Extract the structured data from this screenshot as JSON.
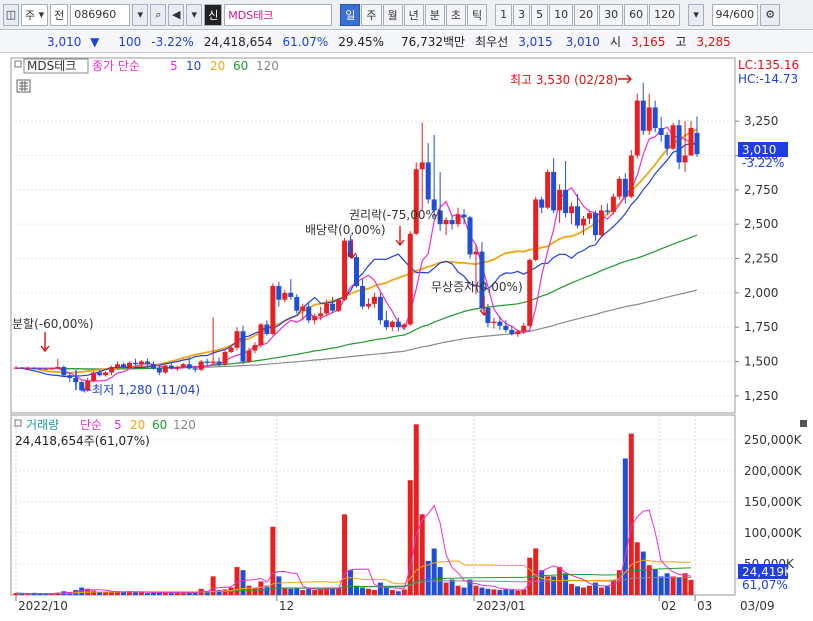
{
  "toolbar": {
    "kind_label": "주",
    "jeon_label": "전",
    "code": "086960",
    "name": "MDS테크",
    "sin_label": "신",
    "periods": [
      "일",
      "주",
      "월",
      "년",
      "분",
      "초",
      "틱"
    ],
    "minutes": [
      "1",
      "3",
      "5",
      "10",
      "20",
      "30",
      "60",
      "120"
    ],
    "count": "94",
    "count_total": "/600"
  },
  "quote": {
    "price": "3,010",
    "change": "100",
    "change_pct": "-3.22%",
    "volume": "24,418,654",
    "vol_ratio": "61.07%",
    "turnover": "29.45%",
    "amount": "76,732백만",
    "bid_label": "최우선",
    "bid1": "3,015",
    "bid2": "3,010",
    "open_label": "시",
    "open": "3,165",
    "high_label": "고",
    "high": "3,285"
  },
  "price_panel": {
    "name_tag": "MDS테크",
    "ma_label": "종가 단순",
    "ma_periods": [
      "5",
      "10",
      "20",
      "60",
      "120"
    ],
    "lc": "LC:135.16",
    "hc": "HC:-14.73",
    "current_price": "3,010",
    "current_pct": "-3.22%",
    "annotations": {
      "high": "최고 3,530 (02/28)",
      "low": "←최저 1,280 (11/04)",
      "split": "분할(-60,00%)",
      "dividend": "배당락(0,00%)",
      "rights": "권리락(-75,00%)",
      "bonus": "무상증자(0,00%)"
    }
  },
  "volume_panel": {
    "label": "거래량",
    "ma_label": "단순",
    "ma_periods": [
      "5",
      "20",
      "60",
      "120"
    ],
    "volume_text": "24,418,654주(61,07%)",
    "current": "24,419K",
    "current_pct": "61,07%"
  },
  "colors": {
    "up": "#e82020",
    "down": "#1e4fd6",
    "ma5": "#ee2ecf",
    "ma10": "#1f3fd9",
    "ma20": "#f0a612",
    "ma60": "#1e9a2e",
    "ma120": "#8a8a8a"
  },
  "chart_data": {
    "type": "candlestick",
    "price_axis": {
      "ticks": [
        1250,
        1500,
        1750,
        2000,
        2250,
        2500,
        2750,
        3000,
        3250
      ],
      "tick_labels": [
        "1,250",
        "1,500",
        "1,750",
        "2,000",
        "2,250",
        "2,500",
        "2,750",
        "3,000",
        "3,250"
      ],
      "range": [
        1125,
        3710
      ]
    },
    "volume_axis": {
      "ticks": [
        50,
        100,
        150,
        200,
        250
      ],
      "tick_labels": [
        "50,000K",
        "100,000K",
        "150,000K",
        "200,000K",
        "250,000K"
      ],
      "range": [
        0,
        290
      ],
      "unit": "K"
    },
    "x_labels": [
      "2022/10",
      "12",
      "2023/01",
      "02",
      "03",
      "03/09"
    ],
    "candles": [
      [
        1455,
        1465,
        1445,
        1455
      ],
      [
        1455,
        1460,
        1445,
        1450
      ],
      [
        1452,
        1462,
        1445,
        1452
      ],
      [
        1452,
        1460,
        1445,
        1450
      ],
      [
        1450,
        1455,
        1440,
        1448
      ],
      [
        1448,
        1452,
        1440,
        1445
      ],
      [
        1445,
        1455,
        1440,
        1450
      ],
      [
        1450,
        1520,
        1445,
        1460
      ],
      [
        1460,
        1470,
        1390,
        1400
      ],
      [
        1400,
        1420,
        1350,
        1380
      ],
      [
        1380,
        1400,
        1330,
        1350
      ],
      [
        1350,
        1360,
        1280,
        1290
      ],
      [
        1290,
        1380,
        1280,
        1360
      ],
      [
        1360,
        1430,
        1350,
        1420
      ],
      [
        1420,
        1440,
        1390,
        1400
      ],
      [
        1400,
        1430,
        1390,
        1420
      ],
      [
        1420,
        1470,
        1400,
        1460
      ],
      [
        1460,
        1500,
        1440,
        1480
      ],
      [
        1480,
        1490,
        1450,
        1460
      ],
      [
        1460,
        1500,
        1450,
        1490
      ],
      [
        1490,
        1520,
        1470,
        1480
      ],
      [
        1480,
        1510,
        1460,
        1500
      ],
      [
        1500,
        1520,
        1470,
        1480
      ],
      [
        1480,
        1500,
        1440,
        1450
      ],
      [
        1450,
        1470,
        1400,
        1420
      ],
      [
        1420,
        1480,
        1410,
        1470
      ],
      [
        1470,
        1490,
        1440,
        1450
      ],
      [
        1450,
        1470,
        1430,
        1460
      ],
      [
        1460,
        1490,
        1450,
        1480
      ],
      [
        1480,
        1530,
        1440,
        1450
      ],
      [
        1450,
        1470,
        1420,
        1440
      ],
      [
        1440,
        1510,
        1430,
        1500
      ],
      [
        1500,
        1520,
        1470,
        1490
      ],
      [
        1490,
        1820,
        1480,
        1500
      ],
      [
        1500,
        1530,
        1460,
        1480
      ],
      [
        1480,
        1580,
        1470,
        1570
      ],
      [
        1570,
        1620,
        1560,
        1600
      ],
      [
        1600,
        1750,
        1580,
        1720
      ],
      [
        1720,
        1760,
        1480,
        1500
      ],
      [
        1500,
        1600,
        1490,
        1580
      ],
      [
        1580,
        1640,
        1560,
        1620
      ],
      [
        1620,
        1780,
        1600,
        1770
      ],
      [
        1770,
        1800,
        1690,
        1700
      ],
      [
        1700,
        2070,
        1690,
        2050
      ],
      [
        2050,
        2080,
        1900,
        1950
      ],
      [
        1950,
        2020,
        1930,
        2000
      ],
      [
        2000,
        2100,
        1950,
        1970
      ],
      [
        1970,
        1990,
        1850,
        1870
      ],
      [
        1870,
        1920,
        1800,
        1900
      ],
      [
        1900,
        1930,
        1780,
        1800
      ],
      [
        1800,
        1850,
        1770,
        1830
      ],
      [
        1830,
        1900,
        1800,
        1850
      ],
      [
        1850,
        1950,
        1830,
        1920
      ],
      [
        1920,
        1970,
        1850,
        1870
      ],
      [
        1870,
        1960,
        1860,
        1950
      ],
      [
        1950,
        2400,
        1940,
        2380
      ],
      [
        2380,
        2420,
        2250,
        2260
      ],
      [
        2260,
        2280,
        2040,
        2050
      ],
      [
        2050,
        2100,
        1880,
        1900
      ],
      [
        1900,
        1960,
        1880,
        1920
      ],
      [
        1920,
        2000,
        1890,
        1970
      ],
      [
        1970,
        2000,
        1770,
        1800
      ],
      [
        1800,
        1870,
        1730,
        1750
      ],
      [
        1750,
        1800,
        1720,
        1790
      ],
      [
        1790,
        1820,
        1720,
        1750
      ],
      [
        1750,
        1780,
        1740,
        1770
      ],
      [
        1770,
        2450,
        1760,
        2430
      ],
      [
        2430,
        2950,
        2420,
        2900
      ],
      [
        2900,
        3240,
        2600,
        2950
      ],
      [
        2950,
        3090,
        2650,
        2680
      ],
      [
        2680,
        3150,
        2550,
        2600
      ],
      [
        2600,
        2880,
        2450,
        2500
      ],
      [
        2500,
        2550,
        2420,
        2530
      ],
      [
        2530,
        2560,
        2460,
        2500
      ],
      [
        2500,
        2620,
        2480,
        2570
      ],
      [
        2570,
        2610,
        2500,
        2550
      ],
      [
        2550,
        2560,
        2250,
        2280
      ],
      [
        2280,
        2350,
        1990,
        2300
      ],
      [
        2300,
        2370,
        1870,
        1890
      ],
      [
        1890,
        1920,
        1750,
        1780
      ],
      [
        1780,
        1820,
        1740,
        1790
      ],
      [
        1790,
        1830,
        1730,
        1760
      ],
      [
        1760,
        1800,
        1710,
        1730
      ],
      [
        1730,
        1760,
        1690,
        1700
      ],
      [
        1700,
        1730,
        1680,
        1720
      ],
      [
        1720,
        1780,
        1700,
        1760
      ],
      [
        1760,
        2250,
        1750,
        2240
      ],
      [
        2240,
        2700,
        2230,
        2680
      ],
      [
        2680,
        2700,
        2580,
        2620
      ],
      [
        2620,
        2900,
        2610,
        2880
      ],
      [
        2880,
        2980,
        2580,
        2600
      ],
      [
        2600,
        2790,
        2510,
        2750
      ],
      [
        2750,
        2960,
        2550,
        2580
      ],
      [
        2580,
        2660,
        2500,
        2630
      ],
      [
        2630,
        2720,
        2470,
        2490
      ],
      [
        2490,
        2560,
        2420,
        2540
      ],
      [
        2540,
        2600,
        2500,
        2580
      ],
      [
        2580,
        2600,
        2380,
        2420
      ],
      [
        2420,
        2640,
        2410,
        2600
      ],
      [
        2600,
        2650,
        2570,
        2590
      ],
      [
        2590,
        2720,
        2570,
        2700
      ],
      [
        2700,
        2850,
        2680,
        2830
      ],
      [
        2830,
        2870,
        2650,
        2700
      ],
      [
        2700,
        3040,
        2690,
        3000
      ],
      [
        3000,
        3450,
        2980,
        3400
      ],
      [
        3400,
        3530,
        3150,
        3180
      ],
      [
        3180,
        3450,
        3150,
        3350
      ],
      [
        3350,
        3400,
        3170,
        3200
      ],
      [
        3200,
        3280,
        3100,
        3150
      ],
      [
        3150,
        3170,
        3000,
        3050
      ],
      [
        3050,
        3240,
        3040,
        3220
      ],
      [
        3220,
        3260,
        2900,
        2950
      ],
      [
        2950,
        3250,
        2880,
        3000
      ],
      [
        3000,
        3250,
        3000,
        3200
      ],
      [
        3165,
        3285,
        2990,
        3010
      ]
    ],
    "ma5": [
      1452,
      1452,
      1452,
      1451,
      1452,
      1451,
      1452,
      1451,
      1428,
      1416,
      1394,
      1367,
      1358,
      1359,
      1358,
      1362,
      1384,
      1417,
      1426,
      1446,
      1465,
      1479,
      1486,
      1479,
      1466,
      1458,
      1452,
      1448,
      1456,
      1469,
      1461,
      1463,
      1463,
      1481,
      1484,
      1501,
      1530,
      1545,
      1560,
      1578,
      1610,
      1621,
      1631,
      1682,
      1723,
      1766,
      1800,
      1786,
      1809,
      1857,
      1821,
      1816,
      1835,
      1857,
      1874,
      1960,
      2041,
      2081,
      2104,
      2128,
      2091,
      2011,
      1934,
      1865,
      1785,
      1733,
      1864,
      2028,
      2233,
      2285,
      2525,
      2622,
      2664,
      2559,
      2574,
      2541,
      2417,
      2350,
      2196,
      2048,
      1883,
      1818,
      1777,
      1757,
      1724,
      1715,
      1729,
      1885,
      2128,
      2304,
      2460,
      2679,
      2737,
      2765,
      2697,
      2631,
      2594,
      2582,
      2561,
      2538,
      2584,
      2641,
      2714,
      2759,
      2856,
      3008,
      3121,
      3137,
      3188,
      3206,
      3143,
      3132,
      3117,
      3095,
      3070
    ],
    "ma10": [
      1452,
      1451,
      1440,
      1433,
      1422,
      1408,
      1402,
      1398,
      1391,
      1393,
      1394,
      1396,
      1400,
      1412,
      1425,
      1441,
      1454,
      1458,
      1460,
      1455,
      1458,
      1457,
      1460,
      1468,
      1472,
      1483,
      1491,
      1499,
      1511,
      1518,
      1535,
      1542,
      1544,
      1562,
      1575,
      1587,
      1611,
      1647,
      1677,
      1685,
      1706,
      1722,
      1755,
      1740,
      1762,
      1798,
      1820,
      1836,
      1890,
      1930,
      1966,
      1924,
      1925,
      1930,
      1956,
      1965,
      2014,
      2097,
      2140,
      2197,
      2244,
      2244,
      2244,
      2264,
      2282,
      2233,
      2186,
      2148,
      2148,
      2145,
      2180,
      2218,
      2230,
      2211,
      2151,
      2122,
      2066,
      2052,
      2044,
      2028,
      2067,
      2124,
      2145,
      2143,
      2156,
      2135,
      2161,
      2184,
      2213,
      2215,
      2257,
      2281,
      2279,
      2252,
      2290,
      2308,
      2338,
      2349,
      2409,
      2445,
      2482,
      2526,
      2577,
      2642,
      2689,
      2751,
      2802,
      2868,
      2918,
      2966,
      3023,
      3041,
      3076,
      3089,
      3091
    ],
    "ma20": [
      1452,
      1452,
      1452,
      1448,
      1440,
      1430,
      1426,
      1425,
      1420,
      1417,
      1420,
      1425,
      1430,
      1436,
      1440,
      1445,
      1450,
      1455,
      1458,
      1459,
      1462,
      1463,
      1468,
      1474,
      1480,
      1490,
      1501,
      1513,
      1526,
      1537,
      1549,
      1558,
      1567,
      1576,
      1586,
      1599,
      1618,
      1640,
      1654,
      1667,
      1689,
      1712,
      1743,
      1756,
      1773,
      1796,
      1816,
      1836,
      1864,
      1887,
      1914,
      1920,
      1930,
      1942,
      1952,
      1972,
      1993,
      2011,
      2022,
      2030,
      2051,
      2063,
      2072,
      2094,
      2109,
      2125,
      2140,
      2159,
      2174,
      2189,
      2204,
      2221,
      2225,
      2226,
      2218,
      2219,
      2213,
      2208,
      2222,
      2228,
      2243,
      2268,
      2289,
      2296,
      2303,
      2300,
      2315,
      2316,
      2330,
      2339,
      2368,
      2393,
      2408,
      2412,
      2428,
      2452,
      2479,
      2503,
      2542,
      2572,
      2610,
      2650,
      2695,
      2739,
      2785,
      2831,
      2881,
      2935,
      2993,
      3044,
      3086,
      3116,
      3146,
      3170,
      3190
    ],
    "ma60": [
      1450,
      1450,
      1450,
      1450,
      1450,
      1449,
      1449,
      1449,
      1448,
      1447,
      1447,
      1446,
      1445,
      1445,
      1445,
      1445,
      1445,
      1446,
      1447,
      1447,
      1448,
      1449,
      1450,
      1451,
      1452,
      1453,
      1455,
      1457,
      1459,
      1461,
      1463,
      1466,
      1469,
      1472,
      1475,
      1479,
      1483,
      1488,
      1493,
      1498,
      1504,
      1510,
      1516,
      1524,
      1530,
      1538,
      1545,
      1552,
      1560,
      1568,
      1577,
      1582,
      1590,
      1598,
      1604,
      1617,
      1627,
      1634,
      1640,
      1649,
      1658,
      1664,
      1670,
      1679,
      1687,
      1693,
      1712,
      1734,
      1755,
      1766,
      1787,
      1803,
      1820,
      1835,
      1850,
      1864,
      1875,
      1883,
      1890,
      1896,
      1901,
      1906,
      1911,
      1915,
      1920,
      1930,
      1942,
      1958,
      1976,
      1991,
      2011,
      2033,
      2052,
      2073,
      2090,
      2108,
      2125,
      2142,
      2162,
      2180,
      2195,
      2214,
      2229,
      2242,
      2253,
      2268,
      2285,
      2302,
      2321,
      2337,
      2354,
      2371,
      2387,
      2404,
      2420
    ],
    "ma120": [
      1450,
      1450,
      1450,
      1450,
      1450,
      1450,
      1449,
      1449,
      1449,
      1448,
      1448,
      1447,
      1447,
      1447,
      1446,
      1446,
      1446,
      1447,
      1447,
      1447,
      1448,
      1448,
      1449,
      1450,
      1451,
      1451,
      1452,
      1453,
      1454,
      1455,
      1456,
      1458,
      1459,
      1460,
      1462,
      1464,
      1466,
      1468,
      1470,
      1472,
      1474,
      1477,
      1480,
      1484,
      1487,
      1491,
      1495,
      1498,
      1502,
      1506,
      1511,
      1514,
      1518,
      1522,
      1526,
      1531,
      1536,
      1540,
      1544,
      1549,
      1553,
      1557,
      1561,
      1566,
      1570,
      1575,
      1585,
      1596,
      1606,
      1613,
      1624,
      1633,
      1642,
      1650,
      1658,
      1666,
      1672,
      1677,
      1682,
      1686,
      1690,
      1694,
      1698,
      1701,
      1705,
      1712,
      1720,
      1730,
      1741,
      1751,
      1763,
      1776,
      1787,
      1800,
      1810,
      1822,
      1833,
      1843,
      1856,
      1867,
      1877,
      1889,
      1899,
      1908,
      1915,
      1925,
      1936,
      1946,
      1958,
      1968,
      1979,
      1989,
      1999,
      2010,
      2020
    ],
    "volume": [
      3,
      2,
      2,
      3,
      2,
      2,
      2,
      4,
      6,
      5,
      8,
      12,
      10,
      7,
      5,
      4,
      5,
      6,
      5,
      6,
      4,
      4,
      3,
      4,
      5,
      4,
      3,
      4,
      3,
      5,
      4,
      10,
      6,
      30,
      8,
      9,
      12,
      45,
      40,
      15,
      12,
      22,
      15,
      110,
      30,
      12,
      10,
      12,
      8,
      10,
      8,
      9,
      12,
      10,
      12,
      130,
      40,
      15,
      12,
      10,
      8,
      20,
      12,
      8,
      6,
      9,
      185,
      275,
      130,
      55,
      75,
      45,
      20,
      25,
      15,
      12,
      25,
      15,
      12,
      10,
      9,
      8,
      9,
      8,
      7,
      9,
      60,
      75,
      40,
      30,
      30,
      45,
      35,
      18,
      14,
      12,
      15,
      20,
      12,
      14,
      25,
      40,
      220,
      260,
      85,
      70,
      48,
      42,
      30,
      35,
      30,
      28,
      35,
      24.4
    ]
  }
}
